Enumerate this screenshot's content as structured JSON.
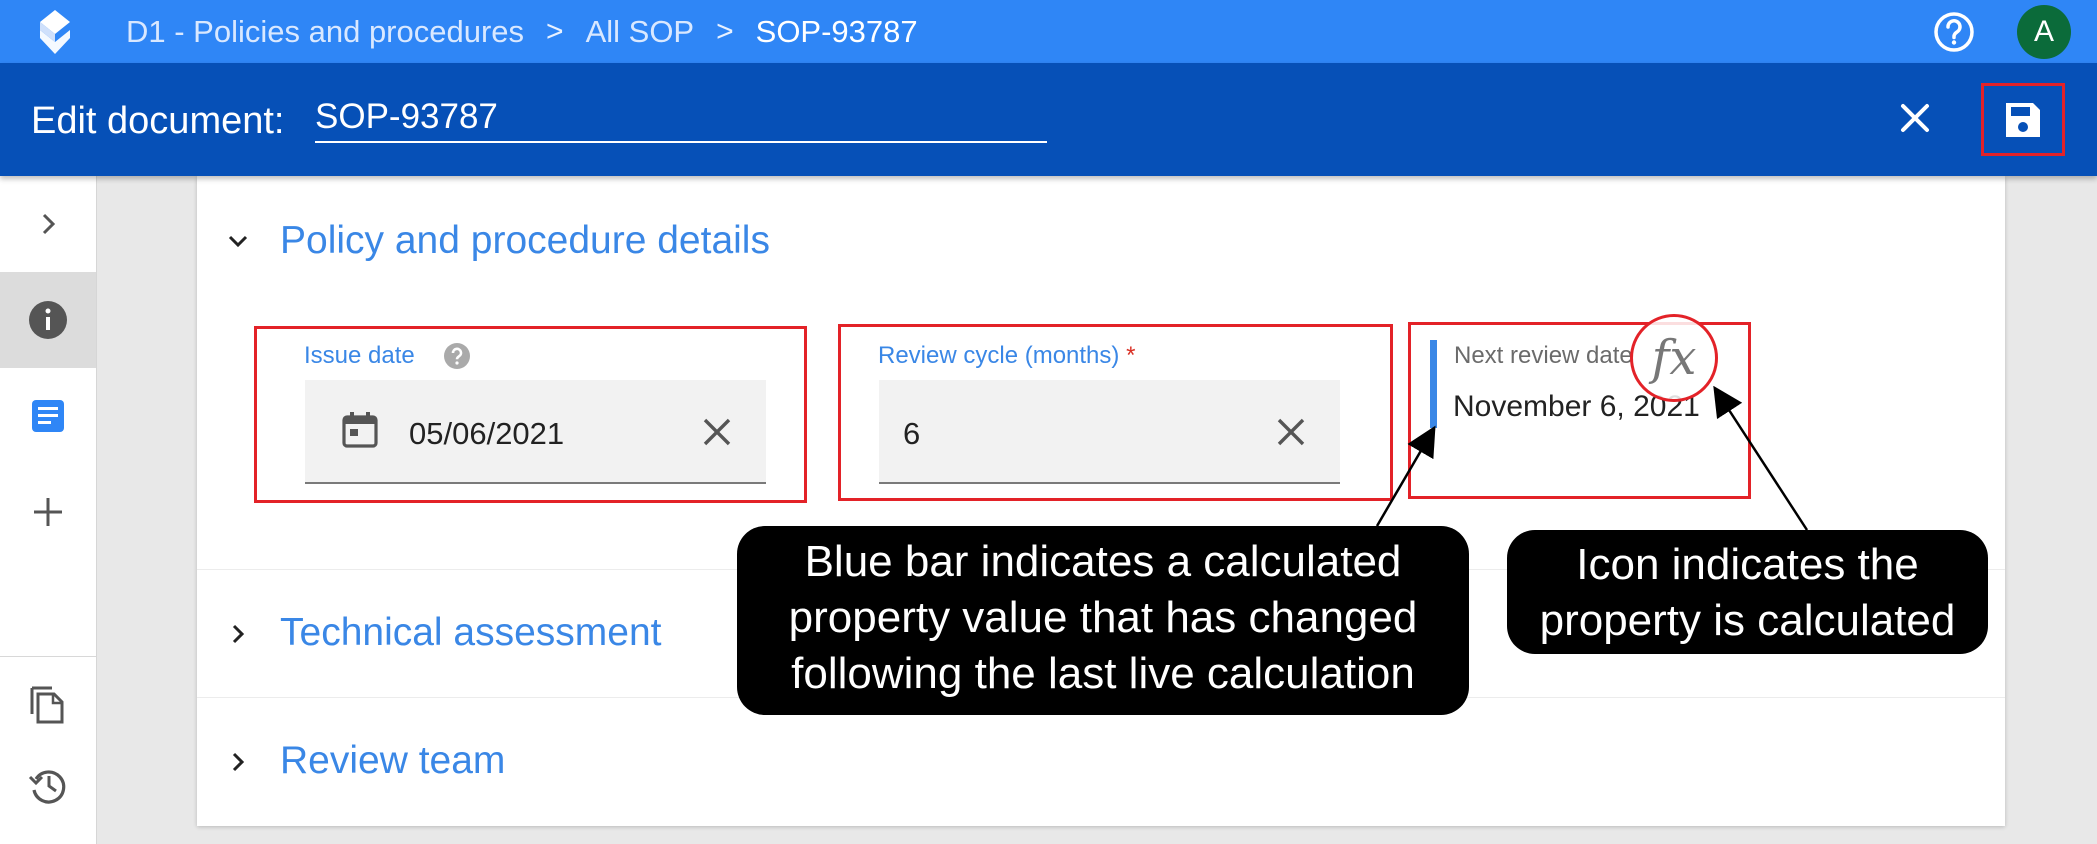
{
  "breadcrumb": {
    "items": [
      "D1 - Policies and procedures",
      "All SOP",
      "SOP-93787"
    ]
  },
  "header": {
    "avatar_letter": "A"
  },
  "edit_bar": {
    "label": "Edit document:",
    "doc_name": "SOP-93787"
  },
  "sections": [
    {
      "title": "Policy and procedure details",
      "expanded": true
    },
    {
      "title": "Technical assessment",
      "expanded": false
    },
    {
      "title": "Review team",
      "expanded": false
    }
  ],
  "fields": {
    "issue_date": {
      "label": "Issue date",
      "value": "05/06/2021"
    },
    "review_cycle": {
      "label": "Review cycle (months)",
      "required_mark": "*",
      "value": "6"
    },
    "next_review": {
      "label": "Next review date",
      "value": "November 6, 2021",
      "calc_icon": "fx"
    }
  },
  "callouts": {
    "blue_bar": {
      "line1": "Blue bar indicates a calculated",
      "line2": "property value that has changed",
      "line3": "following the last live calculation"
    },
    "icon": {
      "line1": "Icon indicates the",
      "line2": "property is calculated"
    }
  },
  "colors": {
    "topbar": "#2f86f6",
    "editbar": "#0650b7",
    "accent": "#3a87e6",
    "annotation_red": "#e32228",
    "calc_bar": "#3a87e6"
  }
}
